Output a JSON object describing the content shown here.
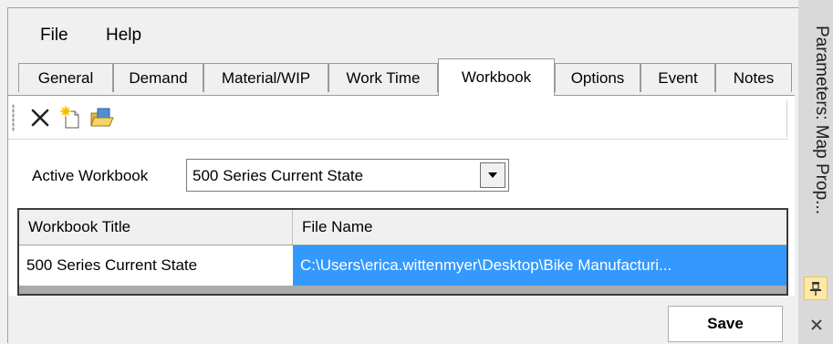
{
  "menu": {
    "file": "File",
    "help": "Help"
  },
  "tabs": [
    {
      "label": "General"
    },
    {
      "label": "Demand"
    },
    {
      "label": "Material/WIP"
    },
    {
      "label": "Work Time"
    },
    {
      "label": "Workbook"
    },
    {
      "label": "Options"
    },
    {
      "label": "Event"
    },
    {
      "label": "Notes"
    }
  ],
  "active_tab": "Workbook",
  "toolbar": {
    "icons": [
      "delete-icon",
      "new-workbook-icon",
      "open-folder-icon"
    ]
  },
  "active_workbook": {
    "label": "Active Workbook",
    "value": "500 Series Current State"
  },
  "grid": {
    "columns": [
      "Workbook Title",
      "File Name"
    ],
    "rows": [
      {
        "title": "500 Series Current State",
        "file": "C:\\Users\\erica.wittenmyer\\Desktop\\Bike Manufacturi..."
      }
    ]
  },
  "save_label": "Save",
  "side_panel": {
    "title": "Parameters: Map Prop..."
  },
  "colors": {
    "selection": "#3399ff",
    "background": "#f0f0f0",
    "pin": "#ffe8a6"
  }
}
